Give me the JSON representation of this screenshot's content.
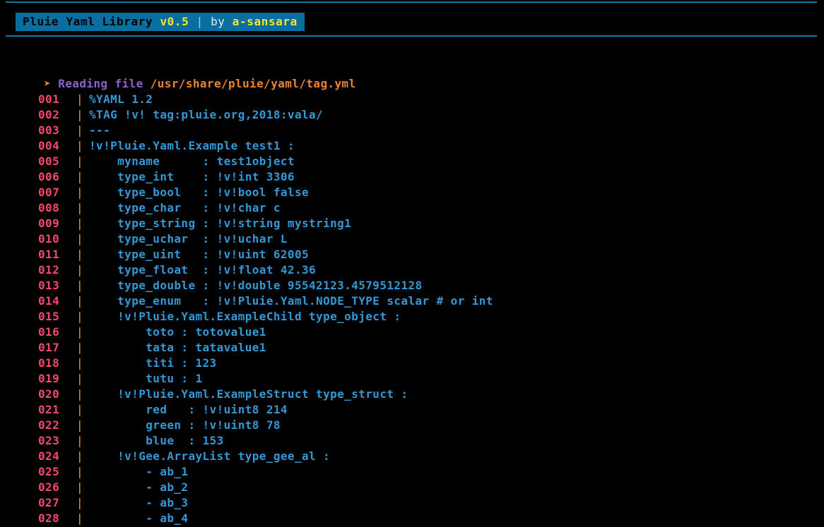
{
  "header": {
    "rule_color": "#0b7aae",
    "banner_bg": "#0a6f9e",
    "title": "Pluie Yaml Library ",
    "version": "v0.5",
    "separator": " | ",
    "by_label": "by ",
    "author": "a-sansara"
  },
  "status": {
    "arrow_icon": "➤ ",
    "label": "Reading file ",
    "path": "/usr/share/pluie/yaml/tag.yml",
    "arrow_color": "#e8852e",
    "label_color": "#8c63c8",
    "path_color": "#e8852e"
  },
  "listing": {
    "gutter_glyph": "|",
    "line_number_color": "#f5486b",
    "gutter_color": "#e8a33d",
    "source_color": "#3399d6",
    "rows": [
      {
        "num": "001",
        "text": "%YAML 1.2"
      },
      {
        "num": "002",
        "text": "%TAG !v! tag:pluie.org,2018:vala/"
      },
      {
        "num": "003",
        "text": "---"
      },
      {
        "num": "004",
        "text": "!v!Pluie.Yaml.Example test1 :"
      },
      {
        "num": "005",
        "text": "    myname      : test1object"
      },
      {
        "num": "006",
        "text": "    type_int    : !v!int 3306"
      },
      {
        "num": "007",
        "text": "    type_bool   : !v!bool false"
      },
      {
        "num": "008",
        "text": "    type_char   : !v!char c"
      },
      {
        "num": "009",
        "text": "    type_string : !v!string mystring1"
      },
      {
        "num": "010",
        "text": "    type_uchar  : !v!uchar L"
      },
      {
        "num": "011",
        "text": "    type_uint   : !v!uint 62005"
      },
      {
        "num": "012",
        "text": "    type_float  : !v!float 42.36"
      },
      {
        "num": "013",
        "text": "    type_double : !v!double 95542123.4579512128"
      },
      {
        "num": "014",
        "text": "    type_enum   : !v!Pluie.Yaml.NODE_TYPE scalar # or int"
      },
      {
        "num": "015",
        "text": "    !v!Pluie.Yaml.ExampleChild type_object :"
      },
      {
        "num": "016",
        "text": "        toto : totovalue1"
      },
      {
        "num": "017",
        "text": "        tata : tatavalue1"
      },
      {
        "num": "018",
        "text": "        titi : 123"
      },
      {
        "num": "019",
        "text": "        tutu : 1"
      },
      {
        "num": "020",
        "text": "    !v!Pluie.Yaml.ExampleStruct type_struct :"
      },
      {
        "num": "021",
        "text": "        red   : !v!uint8 214"
      },
      {
        "num": "022",
        "text": "        green : !v!uint8 78"
      },
      {
        "num": "023",
        "text": "        blue  : 153"
      },
      {
        "num": "024",
        "text": "    !v!Gee.ArrayList type_gee_al :"
      },
      {
        "num": "025",
        "text": "        - ab_1"
      },
      {
        "num": "026",
        "text": "        - ab_2"
      },
      {
        "num": "027",
        "text": "        - ab_3"
      },
      {
        "num": "028",
        "text": "        - ab_4"
      }
    ]
  }
}
